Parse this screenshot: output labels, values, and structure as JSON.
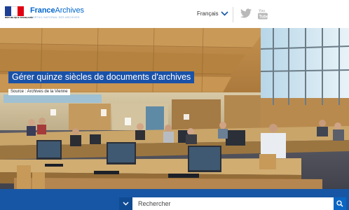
{
  "header": {
    "republic_text": "RÉPUBLIQUE FRANÇAISE",
    "brand_prefix": "France",
    "brand_suffix": "Archives",
    "brand_tagline": "PORTAIL NATIONAL DES ARCHIVES",
    "language": "Français",
    "social": [
      "twitter-icon",
      "youtube-icon"
    ]
  },
  "hero": {
    "title": "Gérer quinze siècles de documents d'archives",
    "source": "Source : Archives de la Vienne"
  },
  "search": {
    "placeholder": "Rechercher"
  },
  "colors": {
    "brand_blue": "#0066cc",
    "title_bg": "#1a52a8",
    "search_bar": "#1756a4",
    "flag_blue": "#1c3f94",
    "flag_red": "#e1000f"
  }
}
